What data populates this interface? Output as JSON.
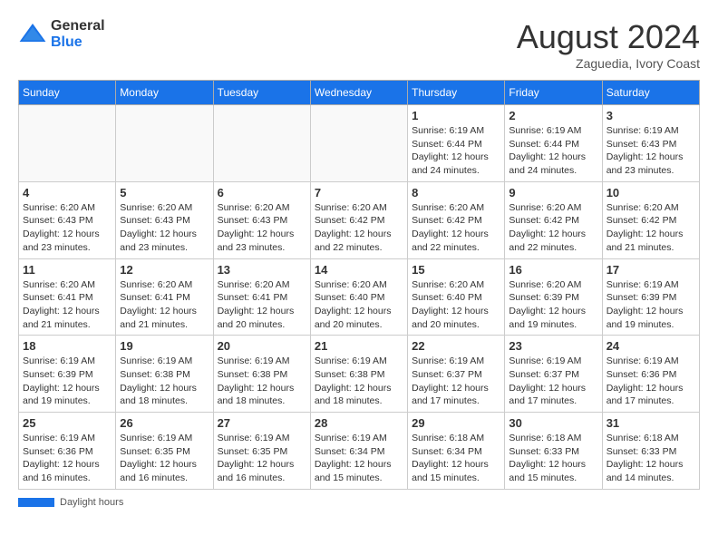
{
  "header": {
    "logo_general": "General",
    "logo_blue": "Blue",
    "month_year": "August 2024",
    "location": "Zaguedia, Ivory Coast"
  },
  "weekdays": [
    "Sunday",
    "Monday",
    "Tuesday",
    "Wednesday",
    "Thursday",
    "Friday",
    "Saturday"
  ],
  "footer": {
    "label": "Daylight hours"
  },
  "weeks": [
    [
      {
        "day": "",
        "info": ""
      },
      {
        "day": "",
        "info": ""
      },
      {
        "day": "",
        "info": ""
      },
      {
        "day": "",
        "info": ""
      },
      {
        "day": "1",
        "info": "Sunrise: 6:19 AM\nSunset: 6:44 PM\nDaylight: 12 hours and 24 minutes."
      },
      {
        "day": "2",
        "info": "Sunrise: 6:19 AM\nSunset: 6:44 PM\nDaylight: 12 hours and 24 minutes."
      },
      {
        "day": "3",
        "info": "Sunrise: 6:19 AM\nSunset: 6:43 PM\nDaylight: 12 hours and 23 minutes."
      }
    ],
    [
      {
        "day": "4",
        "info": "Sunrise: 6:20 AM\nSunset: 6:43 PM\nDaylight: 12 hours and 23 minutes."
      },
      {
        "day": "5",
        "info": "Sunrise: 6:20 AM\nSunset: 6:43 PM\nDaylight: 12 hours and 23 minutes."
      },
      {
        "day": "6",
        "info": "Sunrise: 6:20 AM\nSunset: 6:43 PM\nDaylight: 12 hours and 23 minutes."
      },
      {
        "day": "7",
        "info": "Sunrise: 6:20 AM\nSunset: 6:42 PM\nDaylight: 12 hours and 22 minutes."
      },
      {
        "day": "8",
        "info": "Sunrise: 6:20 AM\nSunset: 6:42 PM\nDaylight: 12 hours and 22 minutes."
      },
      {
        "day": "9",
        "info": "Sunrise: 6:20 AM\nSunset: 6:42 PM\nDaylight: 12 hours and 22 minutes."
      },
      {
        "day": "10",
        "info": "Sunrise: 6:20 AM\nSunset: 6:42 PM\nDaylight: 12 hours and 21 minutes."
      }
    ],
    [
      {
        "day": "11",
        "info": "Sunrise: 6:20 AM\nSunset: 6:41 PM\nDaylight: 12 hours and 21 minutes."
      },
      {
        "day": "12",
        "info": "Sunrise: 6:20 AM\nSunset: 6:41 PM\nDaylight: 12 hours and 21 minutes."
      },
      {
        "day": "13",
        "info": "Sunrise: 6:20 AM\nSunset: 6:41 PM\nDaylight: 12 hours and 20 minutes."
      },
      {
        "day": "14",
        "info": "Sunrise: 6:20 AM\nSunset: 6:40 PM\nDaylight: 12 hours and 20 minutes."
      },
      {
        "day": "15",
        "info": "Sunrise: 6:20 AM\nSunset: 6:40 PM\nDaylight: 12 hours and 20 minutes."
      },
      {
        "day": "16",
        "info": "Sunrise: 6:20 AM\nSunset: 6:39 PM\nDaylight: 12 hours and 19 minutes."
      },
      {
        "day": "17",
        "info": "Sunrise: 6:19 AM\nSunset: 6:39 PM\nDaylight: 12 hours and 19 minutes."
      }
    ],
    [
      {
        "day": "18",
        "info": "Sunrise: 6:19 AM\nSunset: 6:39 PM\nDaylight: 12 hours and 19 minutes."
      },
      {
        "day": "19",
        "info": "Sunrise: 6:19 AM\nSunset: 6:38 PM\nDaylight: 12 hours and 18 minutes."
      },
      {
        "day": "20",
        "info": "Sunrise: 6:19 AM\nSunset: 6:38 PM\nDaylight: 12 hours and 18 minutes."
      },
      {
        "day": "21",
        "info": "Sunrise: 6:19 AM\nSunset: 6:38 PM\nDaylight: 12 hours and 18 minutes."
      },
      {
        "day": "22",
        "info": "Sunrise: 6:19 AM\nSunset: 6:37 PM\nDaylight: 12 hours and 17 minutes."
      },
      {
        "day": "23",
        "info": "Sunrise: 6:19 AM\nSunset: 6:37 PM\nDaylight: 12 hours and 17 minutes."
      },
      {
        "day": "24",
        "info": "Sunrise: 6:19 AM\nSunset: 6:36 PM\nDaylight: 12 hours and 17 minutes."
      }
    ],
    [
      {
        "day": "25",
        "info": "Sunrise: 6:19 AM\nSunset: 6:36 PM\nDaylight: 12 hours and 16 minutes."
      },
      {
        "day": "26",
        "info": "Sunrise: 6:19 AM\nSunset: 6:35 PM\nDaylight: 12 hours and 16 minutes."
      },
      {
        "day": "27",
        "info": "Sunrise: 6:19 AM\nSunset: 6:35 PM\nDaylight: 12 hours and 16 minutes."
      },
      {
        "day": "28",
        "info": "Sunrise: 6:19 AM\nSunset: 6:34 PM\nDaylight: 12 hours and 15 minutes."
      },
      {
        "day": "29",
        "info": "Sunrise: 6:18 AM\nSunset: 6:34 PM\nDaylight: 12 hours and 15 minutes."
      },
      {
        "day": "30",
        "info": "Sunrise: 6:18 AM\nSunset: 6:33 PM\nDaylight: 12 hours and 15 minutes."
      },
      {
        "day": "31",
        "info": "Sunrise: 6:18 AM\nSunset: 6:33 PM\nDaylight: 12 hours and 14 minutes."
      }
    ]
  ]
}
